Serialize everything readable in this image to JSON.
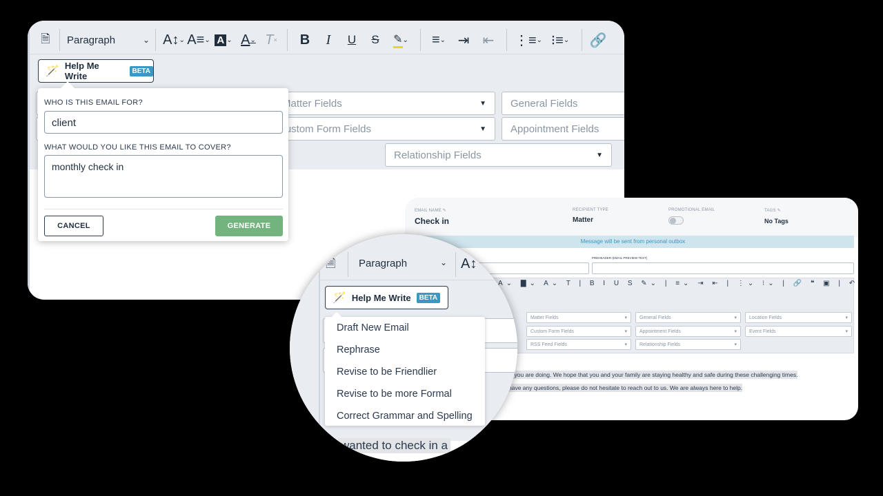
{
  "editor_toolbar": {
    "block_format": "Paragraph",
    "icons": [
      "word-import-icon",
      "font-size-icon",
      "line-height-icon",
      "highlight-text-icon",
      "font-color-icon",
      "clear-format-icon",
      "bold-icon",
      "italic-icon",
      "underline-icon",
      "strikethrough-icon",
      "highlighter-icon",
      "align-icon",
      "indent-icon",
      "outdent-icon",
      "numbered-list-icon",
      "bullet-list-icon",
      "link-icon"
    ]
  },
  "help_me_write": {
    "label": "Help Me Write",
    "badge": "BETA"
  },
  "merge_fields": {
    "matter": "Matter Fields",
    "general": "General Fields",
    "custom_form": "Custom Form Fields",
    "appointment": "Appointment Fields",
    "relationship": "Relationship Fields",
    "location": "Location Fields",
    "event": "Event Fields",
    "rss": "RSS Feed Fields"
  },
  "popup": {
    "recipient_label": "WHO IS THIS EMAIL FOR?",
    "recipient_value": "client",
    "topic_label": "WHAT WOULD YOU LIKE THIS EMAIL TO COVER?",
    "topic_value": "monthly check in",
    "cancel": "CANCEL",
    "generate": "GENERATE"
  },
  "email": {
    "name_label": "EMAIL NAME",
    "name": "Check in",
    "recipient_type_label": "RECIPIENT TYPE",
    "recipient_type": "Matter",
    "promotional_label": "PROMOTIONAL EMAIL",
    "promotional_on": false,
    "tags_label": "TAGS",
    "tags": "No Tags",
    "banner": "Message will be sent from personal outbox",
    "preheader_label": "PREHEADER (EMAIL PREVIEW TEXT)",
    "body_line1": "w you are doing. We hope that you and your family are staying healthy and safe during these challenging times.",
    "body_line2": "have any questions, please do not hesitate to reach out to us. We are always here to help.",
    "body_zoom": "wanted to check in a"
  },
  "menu": {
    "items": [
      "Draft New Email",
      "Rephrase",
      "Revise to be Friendlier",
      "Revise to be more Formal",
      "Correct Grammar and Spelling"
    ]
  },
  "colors": {
    "accent": "#3b97c3",
    "generate": "#72b37e",
    "banner": "#cfe5ee",
    "toolbar_bg": "#e9edf2"
  }
}
